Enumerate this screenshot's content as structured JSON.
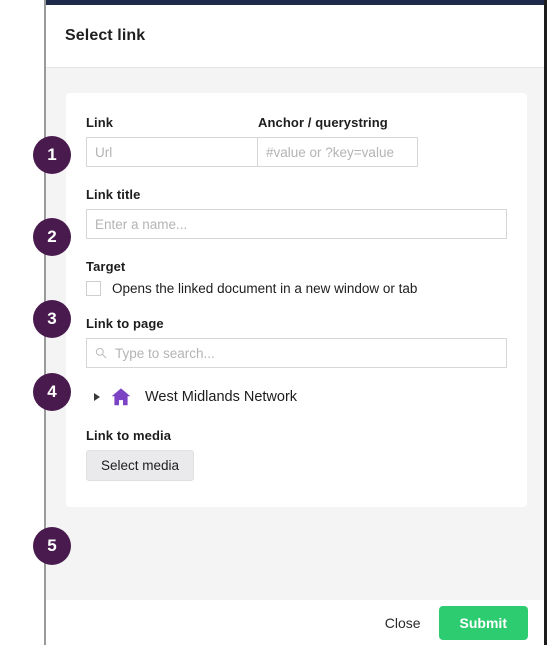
{
  "modal": {
    "title": "Select link",
    "topbar_color": "#1e2a4a",
    "body_background": "#f4f4f5"
  },
  "form": {
    "link": {
      "label": "Link",
      "url_placeholder": "Url",
      "url_value": "",
      "anchor_label": "Anchor / querystring",
      "anchor_placeholder": "#value or ?key=value",
      "anchor_value": ""
    },
    "link_title": {
      "label": "Link title",
      "placeholder": "Enter a name...",
      "value": ""
    },
    "target": {
      "label": "Target",
      "checkbox_label": "Opens the linked document in a new window or tab",
      "checked": false
    },
    "link_to_page": {
      "label": "Link to page",
      "search_placeholder": "Type to search...",
      "search_value": "",
      "search_icon": "search-icon",
      "tree": [
        {
          "label": "West Midlands Network",
          "icon": "home-icon",
          "expanded": false,
          "caret": "caret-right-icon"
        }
      ]
    },
    "link_to_media": {
      "label": "Link to media",
      "button_label": "Select media"
    }
  },
  "footer": {
    "close_label": "Close",
    "submit_label": "Submit",
    "submit_color": "#2ecc71"
  },
  "steps": {
    "badge_color": "#491a4e",
    "items": [
      {
        "number": "1"
      },
      {
        "number": "2"
      },
      {
        "number": "3"
      },
      {
        "number": "4"
      },
      {
        "number": "5"
      }
    ]
  }
}
